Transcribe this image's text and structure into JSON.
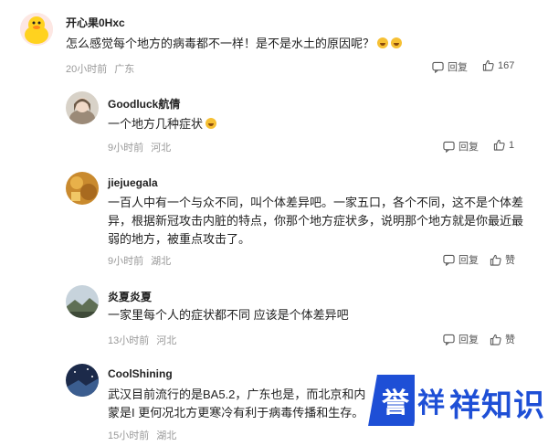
{
  "comments": [
    {
      "username": "开心果0Hxc",
      "text": "怎么感觉每个地方的病毒都不一样！是不是水土的原因呢？",
      "time": "20小时前",
      "location": "广东",
      "reply_label": "回复",
      "like_count": "167",
      "avatar_icon": "yellow-duck-avatar"
    },
    {
      "username": "Goodluck航倩",
      "text": "一个地方几种症状",
      "time": "9小时前",
      "location": "河北",
      "reply_label": "回复",
      "like_count": "1",
      "avatar_icon": "girl-photo-avatar"
    },
    {
      "username": "jiejuegala",
      "text": "一百人中有一个与众不同，叫个体差异吧。一家五口，各个不同，这不是个体差异，根据新冠攻击内脏的特点，你那个地方症状多，说明那个地方就是你最近最弱的地方，被重点攻击了。",
      "time": "9小时前",
      "location": "湖北",
      "reply_label": "回复",
      "like_count": "赞",
      "avatar_icon": "orange-pattern-avatar"
    },
    {
      "username": "炎夏炎夏",
      "text": "一家里每个人的症状都不同 应该是个体差异吧",
      "time": "13小时前",
      "location": "河北",
      "reply_label": "回复",
      "like_count": "赞",
      "avatar_icon": "landscape-avatar"
    },
    {
      "username": "CoolShining",
      "text": "武汉目前流行的是BA5.2，广东也是，而北京和内蒙是I 更何况北方更寒冷有利于病毒传播和生存。",
      "time": "15小时前",
      "location": "湖北",
      "reply_label": "回复",
      "like_count": "赞",
      "avatar_icon": "night-sky-avatar"
    }
  ],
  "watermark": {
    "badge_char": "誉",
    "badge_char2": "祥",
    "text": "祥知识"
  },
  "colors": {
    "watermark_blue": "#1e4fd6",
    "meta_gray": "#999999"
  }
}
